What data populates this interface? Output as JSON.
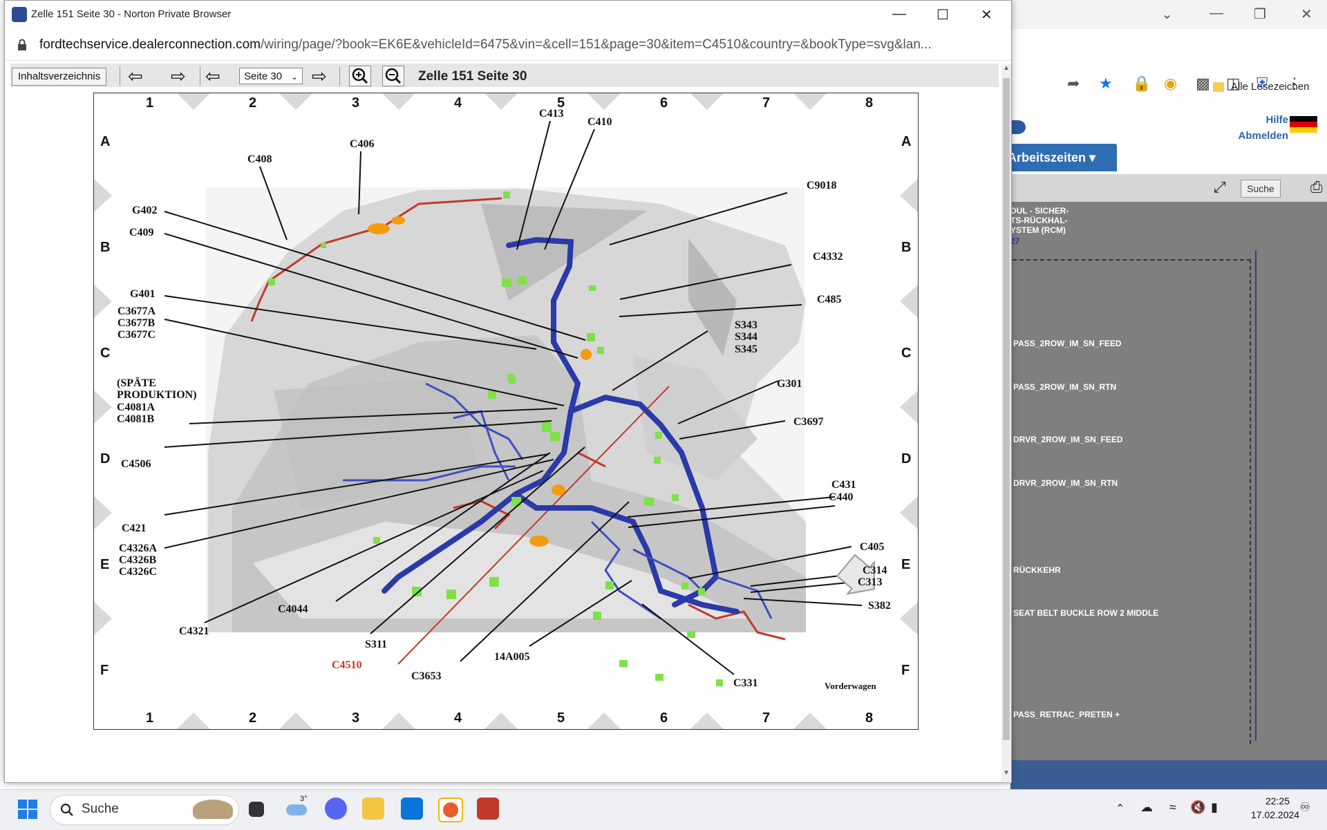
{
  "popup": {
    "title": "Zelle 151 Seite 30 - Norton Private Browser",
    "url_domain": "fordtechservice.dealerconnection.com",
    "url_path": "/wiring/page/?book=EK6E&vehicleId=6475&vin=&cell=151&page=30&item=C4510&country=&bookType=svg&lan..."
  },
  "viewer_toolbar": {
    "toc_label": "Inhaltsverzeichnis",
    "page_select": "Seite 30",
    "title": "Zelle 151 Seite 30"
  },
  "diagram": {
    "columns": [
      "1",
      "2",
      "3",
      "4",
      "5",
      "6",
      "7",
      "8"
    ],
    "rows": [
      "A",
      "B",
      "C",
      "D",
      "E",
      "F"
    ],
    "labels": {
      "c413": "C413",
      "c410": "C410",
      "c406": "C406",
      "c408": "C408",
      "c9018": "C9018",
      "g402": "G402",
      "c409": "C409",
      "c4332": "C4332",
      "c485": "C485",
      "g401": "G401",
      "c3677a": "C3677A",
      "c3677b": "C3677B",
      "c3677c": "C3677C",
      "s343": "S343",
      "s344": "S344",
      "s345": "S345",
      "spaete": "(SPÄTE",
      "produktion": "PRODUKTION)",
      "c4081a": "C4081A",
      "c4081b": "C4081B",
      "g301": "G301",
      "c3697": "C3697",
      "c4506": "C4506",
      "c431": "C431",
      "c440": "C440",
      "c421": "C421",
      "c4326a": "C4326A",
      "c4326b": "C4326B",
      "c4326c": "C4326C",
      "c405": "C405",
      "c314": "C314",
      "c313": "C313",
      "c382": "S382",
      "c4044": "C4044",
      "c4321": "C4321",
      "s311": "S311",
      "c4510": "C4510",
      "c3653": "C3653",
      "a14a005": "14A005",
      "c331": "C331",
      "vorderwagen": "Vorderwagen"
    }
  },
  "bg_browser": {
    "bookmarks": "Alle Lesezeichen",
    "help": "Hilfe",
    "logout": "Abmelden",
    "menu": "Arbeitszeiten",
    "search_btn": "Suche",
    "rcm_title": [
      "DUL - SICHER-",
      "TS-RÜCKHAL-",
      "YSTEM (RCM)"
    ],
    "rcm_link": "27",
    "signals": [
      {
        "label": "PASS_2ROW_IM_SN_FEED"
      },
      {
        "label": "PASS_2ROW_IM_SN_RTN"
      },
      {
        "label": "DRVR_2ROW_IM_SN_FEED"
      },
      {
        "label": "DRVR_2ROW_IM_SN_RTN"
      },
      {
        "label": "RÜCKKEHR"
      },
      {
        "label": "SEAT BELT BUCKLE ROW 2 MIDDLE"
      },
      {
        "label": "PASS_RETRAC_PRETEN +"
      }
    ]
  },
  "taskbar": {
    "search": "Suche",
    "weather_temp": "3°",
    "time": "22:25",
    "date": "17.02.2024"
  }
}
